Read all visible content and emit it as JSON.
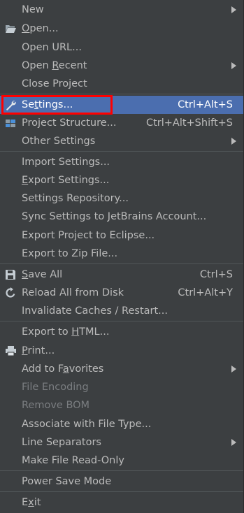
{
  "menu": {
    "items": [
      {
        "key": "new",
        "label": "New",
        "arrow": true
      },
      {
        "key": "open",
        "label": "Open...",
        "icon": "folder-open-icon"
      },
      {
        "key": "open_url",
        "label": "Open URL..."
      },
      {
        "key": "open_recent",
        "label": "Open Recent",
        "arrow": true
      },
      {
        "key": "close_project",
        "label": "Close Project"
      },
      {
        "key": "settings",
        "label": "Settings...",
        "shortcut": "Ctrl+Alt+S",
        "icon": "wrench-icon",
        "selected": true
      },
      {
        "key": "project_structure",
        "label": "Project Structure...",
        "shortcut": "Ctrl+Alt+Shift+S",
        "icon": "project-structure-icon"
      },
      {
        "key": "other_settings",
        "label": "Other Settings",
        "arrow": true
      },
      {
        "key": "import_settings",
        "label": "Import Settings..."
      },
      {
        "key": "export_settings",
        "label": "Export Settings..."
      },
      {
        "key": "settings_repository",
        "label": "Settings Repository..."
      },
      {
        "key": "sync_settings",
        "label": "Sync Settings to JetBrains Account..."
      },
      {
        "key": "export_eclipse",
        "label": "Export Project to Eclipse..."
      },
      {
        "key": "export_zip",
        "label": "Export to Zip File..."
      },
      {
        "key": "save_all",
        "label": "Save All",
        "shortcut": "Ctrl+S",
        "icon": "save-icon"
      },
      {
        "key": "reload_all",
        "label": "Reload All from Disk",
        "shortcut": "Ctrl+Alt+Y",
        "icon": "reload-icon"
      },
      {
        "key": "invalidate_caches",
        "label": "Invalidate Caches / Restart..."
      },
      {
        "key": "export_html",
        "label": "Export to HTML..."
      },
      {
        "key": "print",
        "label": "Print...",
        "icon": "printer-icon"
      },
      {
        "key": "add_favorites",
        "label": "Add to Favorites",
        "arrow": true
      },
      {
        "key": "file_encoding",
        "label": "File Encoding",
        "disabled": true
      },
      {
        "key": "remove_bom",
        "label": "Remove BOM",
        "disabled": true
      },
      {
        "key": "associate_file_type",
        "label": "Associate with File Type..."
      },
      {
        "key": "line_separators",
        "label": "Line Separators",
        "arrow": true
      },
      {
        "key": "make_read_only",
        "label": "Make File Read-Only"
      },
      {
        "key": "power_save",
        "label": "Power Save Mode"
      },
      {
        "key": "exit",
        "label": "Exit"
      }
    ]
  },
  "colors": {
    "background": "#3c3f41",
    "selection": "#4b6eaf",
    "text": "#bbbbbb",
    "disabled_text": "#7a7d80",
    "highlight_box": "#ff0000"
  }
}
